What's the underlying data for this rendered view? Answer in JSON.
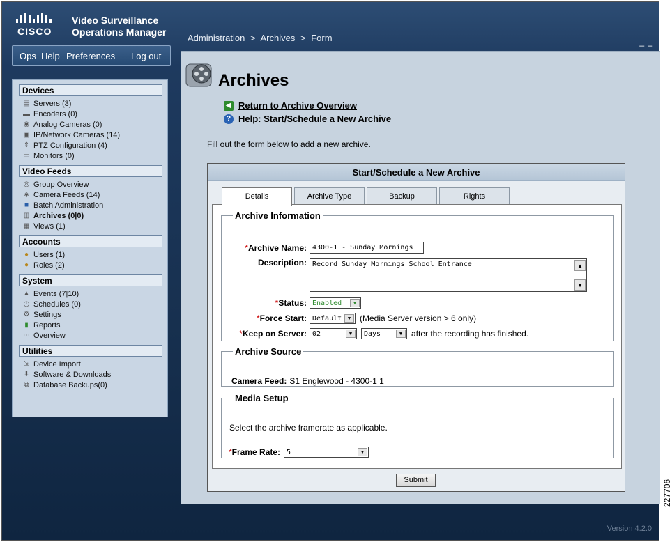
{
  "brand": {
    "company": "CISCO",
    "product_line1": "Video Surveillance",
    "product_line2": "Operations Manager"
  },
  "breadcrumb": [
    "Administration",
    ">",
    "Archives",
    ">",
    "Form"
  ],
  "window_controls": "_ _",
  "top_menu": {
    "ops": "Ops",
    "help": "Help",
    "preferences": "Preferences",
    "logout": "Log out"
  },
  "sidebar": {
    "devices": {
      "title": "Devices",
      "items": [
        "Servers (3)",
        "Encoders (0)",
        "Analog Cameras (0)",
        "IP/Network Cameras (14)",
        "PTZ Configuration (4)",
        "Monitors (0)"
      ]
    },
    "video_feeds": {
      "title": "Video Feeds",
      "items": [
        "Group Overview",
        "Camera Feeds (14)",
        "Batch Administration",
        "Archives (0|0)",
        "Views (1)"
      ]
    },
    "accounts": {
      "title": "Accounts",
      "items": [
        "Users (1)",
        "Roles (2)"
      ]
    },
    "system": {
      "title": "System",
      "items": [
        "Events (7|10)",
        "Schedules (0)",
        "Settings",
        "Reports",
        "Overview"
      ]
    },
    "utilities": {
      "title": "Utilities",
      "items": [
        "Device Import",
        "Software & Downloads",
        "Database Backups(0)"
      ]
    }
  },
  "page": {
    "title": "Archives",
    "return_link": "Return to Archive Overview",
    "help_link": "Help: Start/Schedule a New Archive",
    "intro": "Fill out the form below to add a new archive."
  },
  "form": {
    "header": "Start/Schedule a New Archive",
    "tabs": [
      "Details",
      "Archive Type",
      "Backup",
      "Rights"
    ],
    "archive_info": {
      "legend": "Archive Information",
      "name_label": "Archive Name:",
      "name_value": "4300-1 - Sunday Mornings",
      "description_label": "Description:",
      "description_value": "Record Sunday Mornings School Entrance",
      "status_label": "Status:",
      "status_value": "Enabled",
      "force_start_label": "Force Start:",
      "force_start_value": "Default",
      "force_start_note": "(Media Server version > 6 only)",
      "keep_label": "Keep on Server:",
      "keep_amount": "02",
      "keep_unit": "Days",
      "keep_note": "after the recording has finished."
    },
    "archive_source": {
      "legend": "Archive Source",
      "camera_label": "Camera Feed:",
      "camera_value": "S1 Englewood - 4300-1 1"
    },
    "media_setup": {
      "legend": "Media Setup",
      "instructions": "Select the archive framerate as applicable.",
      "frame_rate_label": "Frame Rate:",
      "frame_rate_value": "5"
    },
    "required_mark": "*",
    "submit_label": "Submit"
  },
  "version": "Version 4.2.0",
  "figure_id": "227706",
  "colors": {
    "accent_green": "#2e8b2e",
    "required": "#cc0000",
    "header_blue": "#1e3a5f"
  }
}
